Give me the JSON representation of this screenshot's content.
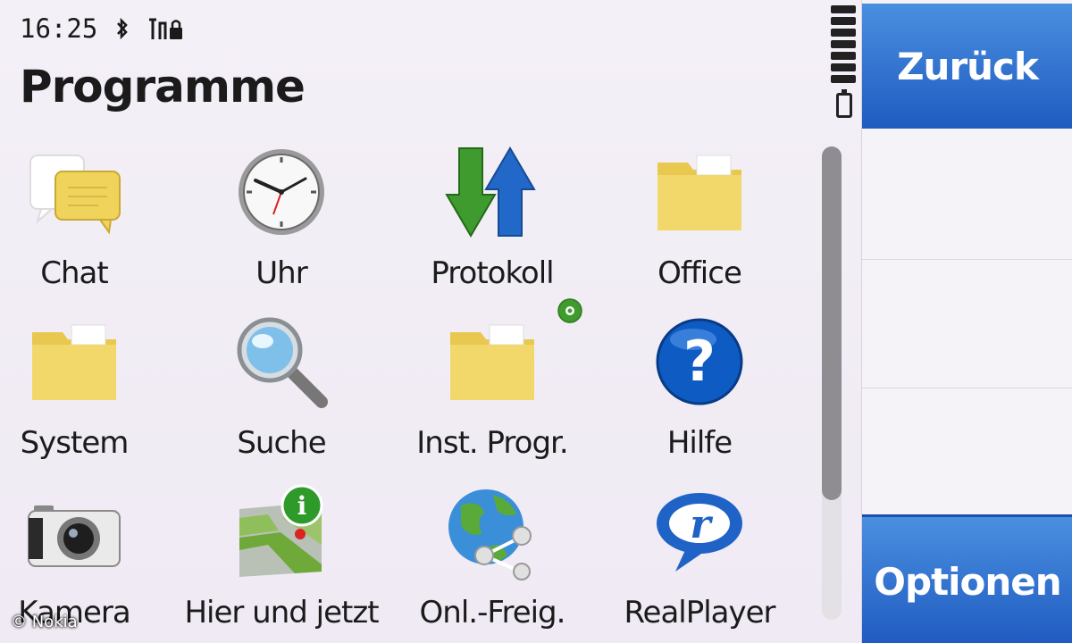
{
  "status": {
    "time": "16:25"
  },
  "title": "Programme",
  "apps": [
    {
      "label": "Chat",
      "icon": "chat-icon"
    },
    {
      "label": "Uhr",
      "icon": "clock-icon"
    },
    {
      "label": "Protokoll",
      "icon": "log-icon"
    },
    {
      "label": "Office",
      "icon": "folder-icon"
    },
    {
      "label": "System",
      "icon": "folder-icon"
    },
    {
      "label": "Suche",
      "icon": "search-icon"
    },
    {
      "label": "Inst. Progr.",
      "icon": "folder-icon"
    },
    {
      "label": "Hilfe",
      "icon": "help-icon"
    },
    {
      "label": "Kamera",
      "icon": "camera-icon"
    },
    {
      "label": "Hier und jetzt",
      "icon": "map-info-icon"
    },
    {
      "label": "Onl.-Freig.",
      "icon": "globe-share-icon"
    },
    {
      "label": "RealPlayer",
      "icon": "realplayer-icon"
    }
  ],
  "softkeys": {
    "back": "Zurück",
    "options": "Optionen"
  },
  "watermark": "© Nokia",
  "colors": {
    "softkey": "#2a68cc",
    "folder": "#f2d86a"
  }
}
